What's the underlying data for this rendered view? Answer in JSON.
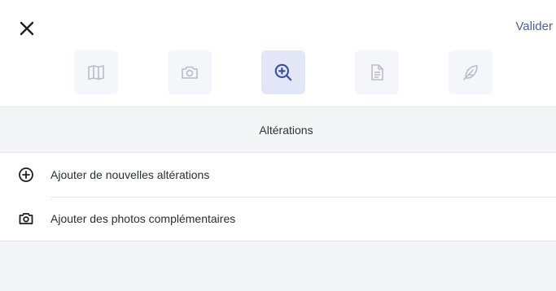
{
  "header": {
    "close_icon": "close-icon",
    "confirm_label": "Valider",
    "tabs": [
      {
        "icon": "book-icon"
      },
      {
        "icon": "camera-icon"
      },
      {
        "icon": "zoom-in-icon",
        "active": true
      },
      {
        "icon": "document-icon"
      },
      {
        "icon": "feather-icon"
      }
    ]
  },
  "section": {
    "title": "Altérations"
  },
  "actions": [
    {
      "icon": "plus-circle-icon",
      "label": "Ajouter de nouvelles altérations"
    },
    {
      "icon": "camera-icon",
      "label": "Ajouter des photos complémentaires"
    }
  ],
  "colors": {
    "accent": "#4a5fa8",
    "active_tab_bg": "#e3e6f6",
    "tab_bg": "#f5f6f9",
    "muted_icon": "#b7bcc8",
    "page_bg": "#f4f5f7"
  }
}
